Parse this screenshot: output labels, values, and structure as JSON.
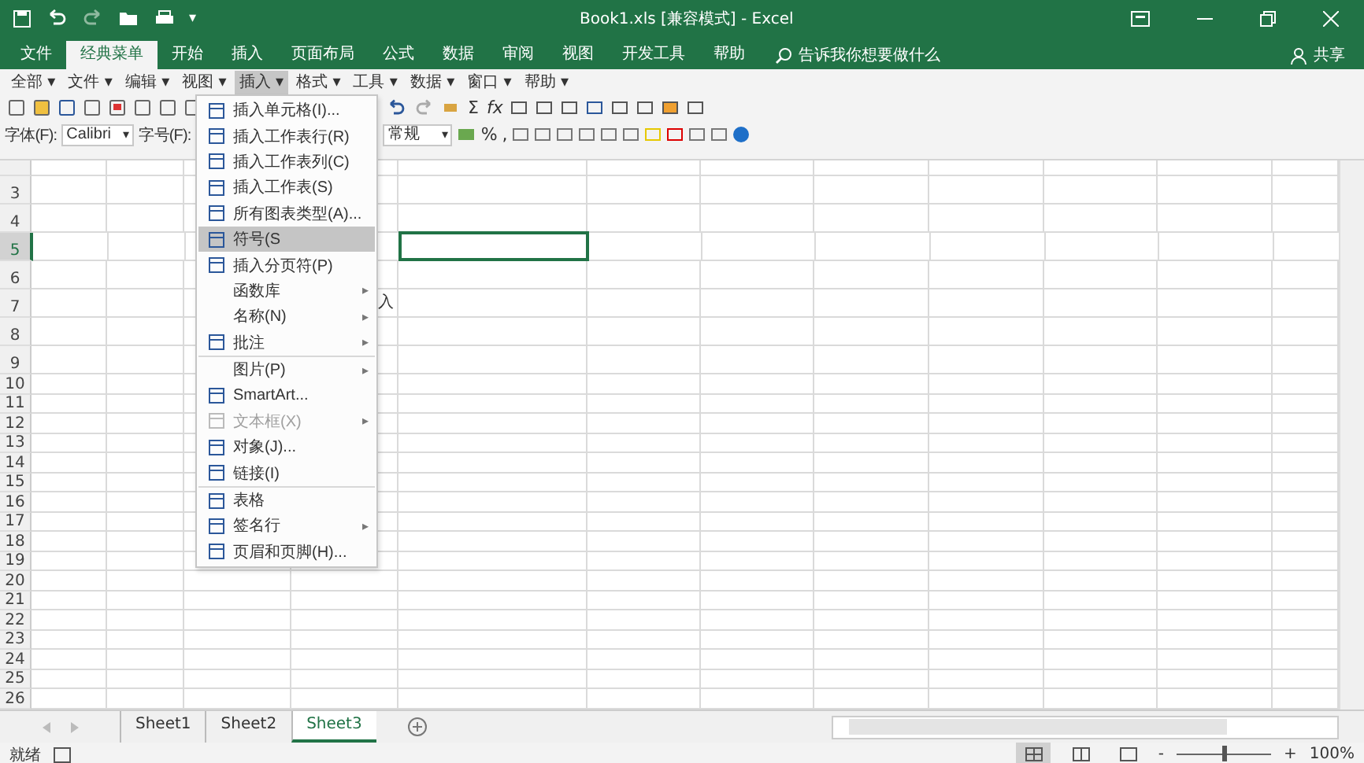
{
  "window": {
    "title": "Book1.xls  [兼容模式]  -  Excel",
    "customize_glyph": "▾"
  },
  "ribbon_tabs": [
    {
      "label": "文件",
      "selected": false
    },
    {
      "label": "经典菜单",
      "selected": true
    },
    {
      "label": "开始",
      "selected": false
    },
    {
      "label": "插入",
      "selected": false
    },
    {
      "label": "页面布局",
      "selected": false
    },
    {
      "label": "公式",
      "selected": false
    },
    {
      "label": "数据",
      "selected": false
    },
    {
      "label": "审阅",
      "selected": false
    },
    {
      "label": "视图",
      "selected": false
    },
    {
      "label": "开发工具",
      "selected": false
    },
    {
      "label": "帮助",
      "selected": false
    }
  ],
  "tell_me": {
    "placeholder": "告诉我你想要做什么"
  },
  "share": {
    "label": "共享"
  },
  "menu_bar": [
    {
      "label": "全部",
      "selected": false
    },
    {
      "label": "文件",
      "selected": false
    },
    {
      "label": "编辑",
      "selected": false
    },
    {
      "label": "视图",
      "selected": false
    },
    {
      "label": "插入",
      "selected": true
    },
    {
      "label": "格式",
      "selected": false
    },
    {
      "label": "工具",
      "selected": false
    },
    {
      "label": "数据",
      "selected": false
    },
    {
      "label": "窗口",
      "selected": false
    },
    {
      "label": "帮助",
      "selected": false
    }
  ],
  "menu_caret": "▾",
  "toolbar": {
    "sum": "Σ",
    "function": "fx",
    "font_label": "字体(F):",
    "font_value": "Calibri",
    "size_label": "字号(F):",
    "dropdown_glyph": "▾",
    "number_format": "常规",
    "percent": "%",
    "comma": ","
  },
  "insert_menu": [
    {
      "label": "插入单元格(I)...",
      "kind": "icon",
      "submenu": false,
      "selected": false,
      "disabled": false,
      "separator_before": false
    },
    {
      "label": "插入工作表行(R)",
      "kind": "icon",
      "submenu": false,
      "selected": false,
      "disabled": false,
      "separator_before": false
    },
    {
      "label": "插入工作表列(C)",
      "kind": "icon",
      "submenu": false,
      "selected": false,
      "disabled": false,
      "separator_before": false
    },
    {
      "label": "插入工作表(S)",
      "kind": "icon",
      "submenu": false,
      "selected": false,
      "disabled": false,
      "separator_before": false
    },
    {
      "label": "所有图表类型(A)...",
      "kind": "icon",
      "submenu": false,
      "selected": false,
      "disabled": false,
      "separator_before": false
    },
    {
      "label": "符号(S",
      "kind": "icon",
      "submenu": false,
      "selected": true,
      "disabled": false,
      "separator_before": false
    },
    {
      "label": "插入分页符(P)",
      "kind": "icon",
      "submenu": false,
      "selected": false,
      "disabled": false,
      "separator_before": false
    },
    {
      "label": "函数库",
      "kind": "plain",
      "submenu": true,
      "selected": false,
      "disabled": false,
      "separator_before": false
    },
    {
      "label": "名称(N)",
      "kind": "plain",
      "submenu": true,
      "selected": false,
      "disabled": false,
      "separator_before": false
    },
    {
      "label": "批注",
      "kind": "icon",
      "submenu": true,
      "selected": false,
      "disabled": false,
      "separator_before": false
    },
    {
      "label": "图片(P)",
      "kind": "plain",
      "submenu": true,
      "selected": false,
      "disabled": false,
      "separator_before": true
    },
    {
      "label": "SmartArt...",
      "kind": "icon",
      "submenu": false,
      "selected": false,
      "disabled": false,
      "separator_before": false
    },
    {
      "label": "文本框(X)",
      "kind": "icon",
      "submenu": true,
      "selected": false,
      "disabled": true,
      "separator_before": false
    },
    {
      "label": "对象(J)...",
      "kind": "icon",
      "submenu": false,
      "selected": false,
      "disabled": false,
      "separator_before": false
    },
    {
      "label": "链接(I)",
      "kind": "icon",
      "submenu": false,
      "selected": false,
      "disabled": false,
      "separator_before": false
    },
    {
      "label": "表格",
      "kind": "icon",
      "submenu": false,
      "selected": false,
      "disabled": false,
      "separator_before": true
    },
    {
      "label": "签名行",
      "kind": "icon",
      "submenu": true,
      "selected": false,
      "disabled": false,
      "separator_before": false
    },
    {
      "label": "页眉和页脚(H)...",
      "kind": "icon",
      "submenu": false,
      "selected": false,
      "disabled": false,
      "separator_before": false
    }
  ],
  "submenu_arrow": "▸",
  "rows": [
    {
      "label": "3",
      "selected": false
    },
    {
      "label": "4",
      "selected": false
    },
    {
      "label": "5",
      "selected": true
    },
    {
      "label": "6",
      "selected": false
    },
    {
      "label": "7",
      "selected": false,
      "text": "入"
    },
    {
      "label": "8",
      "selected": false
    },
    {
      "label": "9",
      "selected": false
    },
    {
      "label": "10",
      "selected": false
    },
    {
      "label": "11",
      "selected": false
    },
    {
      "label": "12",
      "selected": false
    },
    {
      "label": "13",
      "selected": false
    },
    {
      "label": "14",
      "selected": false
    },
    {
      "label": "15",
      "selected": false
    },
    {
      "label": "16",
      "selected": false
    },
    {
      "label": "17",
      "selected": false
    },
    {
      "label": "18",
      "selected": false
    },
    {
      "label": "19",
      "selected": false
    },
    {
      "label": "20",
      "selected": false
    },
    {
      "label": "21",
      "selected": false
    },
    {
      "label": "22",
      "selected": false
    },
    {
      "label": "23",
      "selected": false
    },
    {
      "label": "24",
      "selected": false
    },
    {
      "label": "25",
      "selected": false
    },
    {
      "label": "26",
      "selected": false
    }
  ],
  "sheets": [
    {
      "label": "Sheet1",
      "selected": false
    },
    {
      "label": "Sheet2",
      "selected": false
    },
    {
      "label": "Sheet3",
      "selected": true
    }
  ],
  "status_bar": {
    "ready": "就绪",
    "views": [
      {
        "selected": true
      },
      {
        "selected": false
      },
      {
        "selected": false
      }
    ],
    "zoom_out": "-",
    "zoom_in": "+",
    "zoom": {
      "level": 0.5
    },
    "zoom_label": "100%"
  }
}
